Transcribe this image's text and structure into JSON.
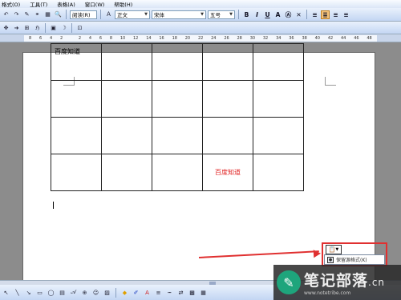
{
  "menubar": {
    "items": [
      "格式(O)",
      "工具(T)",
      "表格(A)",
      "窗口(W)",
      "帮助(H)"
    ]
  },
  "toolbar1": {
    "style_value": "正文",
    "font_value": "宋体",
    "size_value": "五号",
    "bold": "B",
    "italic": "I",
    "underline": "U",
    "font_a": "A",
    "read_label": "阅读(R)"
  },
  "ruler": {
    "ticks": [
      "8",
      "6",
      "4",
      "2",
      "",
      "2",
      "4",
      "6",
      "8",
      "10",
      "12",
      "14",
      "16",
      "18",
      "20",
      "22",
      "24",
      "26",
      "28",
      "30",
      "32",
      "34",
      "36",
      "38",
      "40",
      "42",
      "44",
      "46",
      "48"
    ]
  },
  "table": {
    "rows": [
      [
        "百度知道",
        "",
        "",
        "",
        ""
      ],
      [
        "",
        "",
        "",
        "",
        ""
      ],
      [
        "",
        "",
        "",
        "",
        ""
      ],
      [
        "",
        "",
        "",
        "百度知道",
        ""
      ]
    ],
    "red_cell_text": "百度知道"
  },
  "paste_options": {
    "menu_label": "保留源格式(K)"
  },
  "watermark": {
    "main": "笔记部落",
    "suffix": ".cn",
    "url": "www.notetribe.com"
  },
  "colors": {
    "accent_red": "#e03030",
    "brand_green": "#1ea57c"
  }
}
